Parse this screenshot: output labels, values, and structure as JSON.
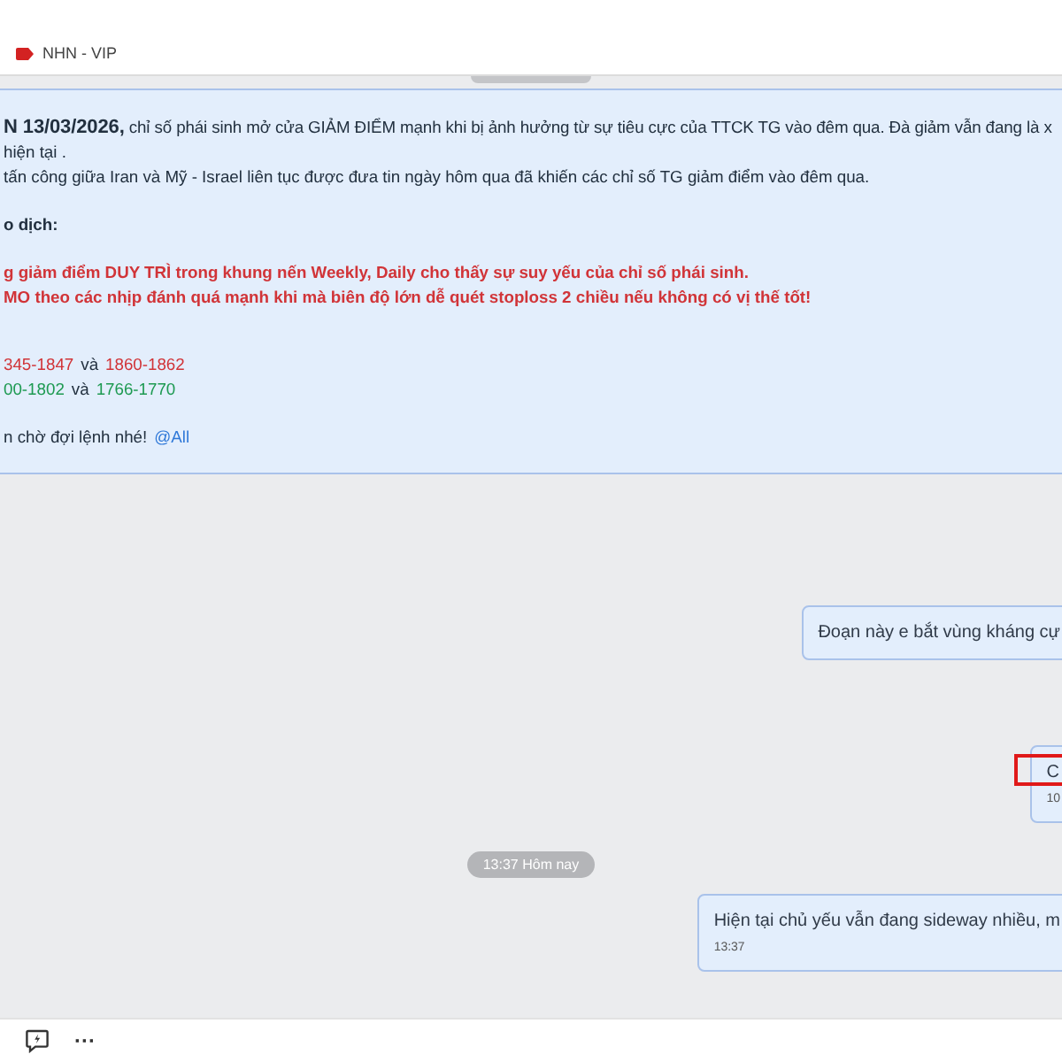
{
  "header": {
    "tag": "NHN - VIP"
  },
  "post": {
    "paragraphs": [
      [
        [
          {
            "text": "**N 13/03/2026,** chỉ số phái sinh mở cửa GIẢM ĐIỂM mạnh khi bị ảnh hưởng từ sự tiêu cực của TTCK TG vào đêm qua. Đà giảm vẫn đang là x",
            "kind": "plain"
          }
        ],
        [
          {
            "text": "hiện tại .",
            "kind": "plain"
          }
        ],
        [
          {
            "text": "tấn công giữa Iran và Mỹ - Israel liên tục được đưa tin ngày hôm qua đã khiến các chỉ số TG giảm điểm vào đêm qua.",
            "kind": "plain"
          }
        ]
      ],
      [
        [
          {
            "text": "o dịch:",
            "kind": "heading"
          }
        ]
      ],
      [
        [
          {
            "text": "g giảm điểm DUY TRÌ trong khung nến Weekly, Daily cho thấy sự suy yếu của chỉ số phái sinh.",
            "kind": "alert"
          }
        ],
        [
          {
            "text": "MO theo các nhịp đánh quá mạnh khi mà biên độ lớn dễ quét stoploss 2 chiều nếu không có vị thế tốt!",
            "kind": "alert"
          }
        ]
      ],
      [
        [
          {
            "text": "345-1847",
            "kind": "up"
          },
          {
            "text": "và",
            "kind": "plain"
          },
          {
            "text": "1860-1862",
            "kind": "up"
          }
        ],
        [
          {
            "text": "00-1802",
            "kind": "down"
          },
          {
            "text": "và",
            "kind": "plain"
          },
          {
            "text": "1766-1770",
            "kind": "down"
          }
        ]
      ],
      [
        [
          {
            "text": "n chờ đợi lệnh nhé!",
            "kind": "plain"
          },
          {
            "text": "@All",
            "kind": "mention"
          }
        ]
      ]
    ]
  },
  "messages": [
    {
      "kind": "bubble",
      "text": "Đoạn này e bắt vùng kháng cự",
      "highlighted": false
    },
    {
      "kind": "bubble",
      "text": "C",
      "time": "10",
      "highlighted": true
    },
    {
      "kind": "divider",
      "text": "13:37 Hôm nay"
    },
    {
      "kind": "bubble",
      "text": "Hiện tại chủ yếu vẫn đang sideway nhiều, m",
      "time": "13:37",
      "highlighted": false
    }
  ],
  "toolbar": {
    "more": "···"
  }
}
